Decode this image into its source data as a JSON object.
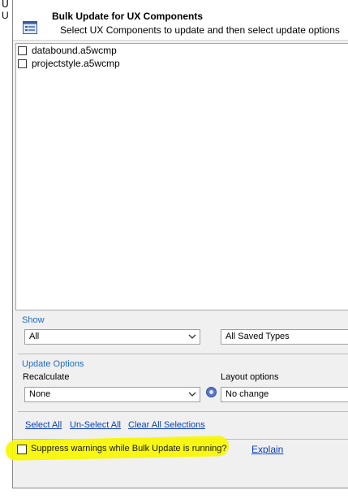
{
  "background": {
    "fragment_top": "U"
  },
  "dialog": {
    "title": "Bulk Update for UX Components",
    "subtitle": "Select UX Components to update and then select update options",
    "icon": "component-list-icon"
  },
  "components": [
    {
      "name": "databound.a5wcmp",
      "checked": false
    },
    {
      "name": "projectstyle.a5wcmp",
      "checked": false
    }
  ],
  "show": {
    "group_label": "Show",
    "filter_value": "All",
    "types_value": "All Saved Types"
  },
  "update_options": {
    "group_label": "Update Options",
    "recalculate_label": "Recalculate",
    "recalculate_value": "None",
    "layout_label": "Layout options",
    "layout_value": "No change",
    "help_icon": "help-icon"
  },
  "selection_links": {
    "select_all": "Select All",
    "unselect_all": "Un-Select All",
    "clear_all": "Clear All Selections"
  },
  "footer": {
    "suppress_label": "Suppress warnings while Bulk Update is running?",
    "suppress_checked": false,
    "explain": "Explain"
  },
  "colors": {
    "highlight": "#f7f700",
    "group_label": "#1e6bc5",
    "link": "#0a3fb8"
  }
}
